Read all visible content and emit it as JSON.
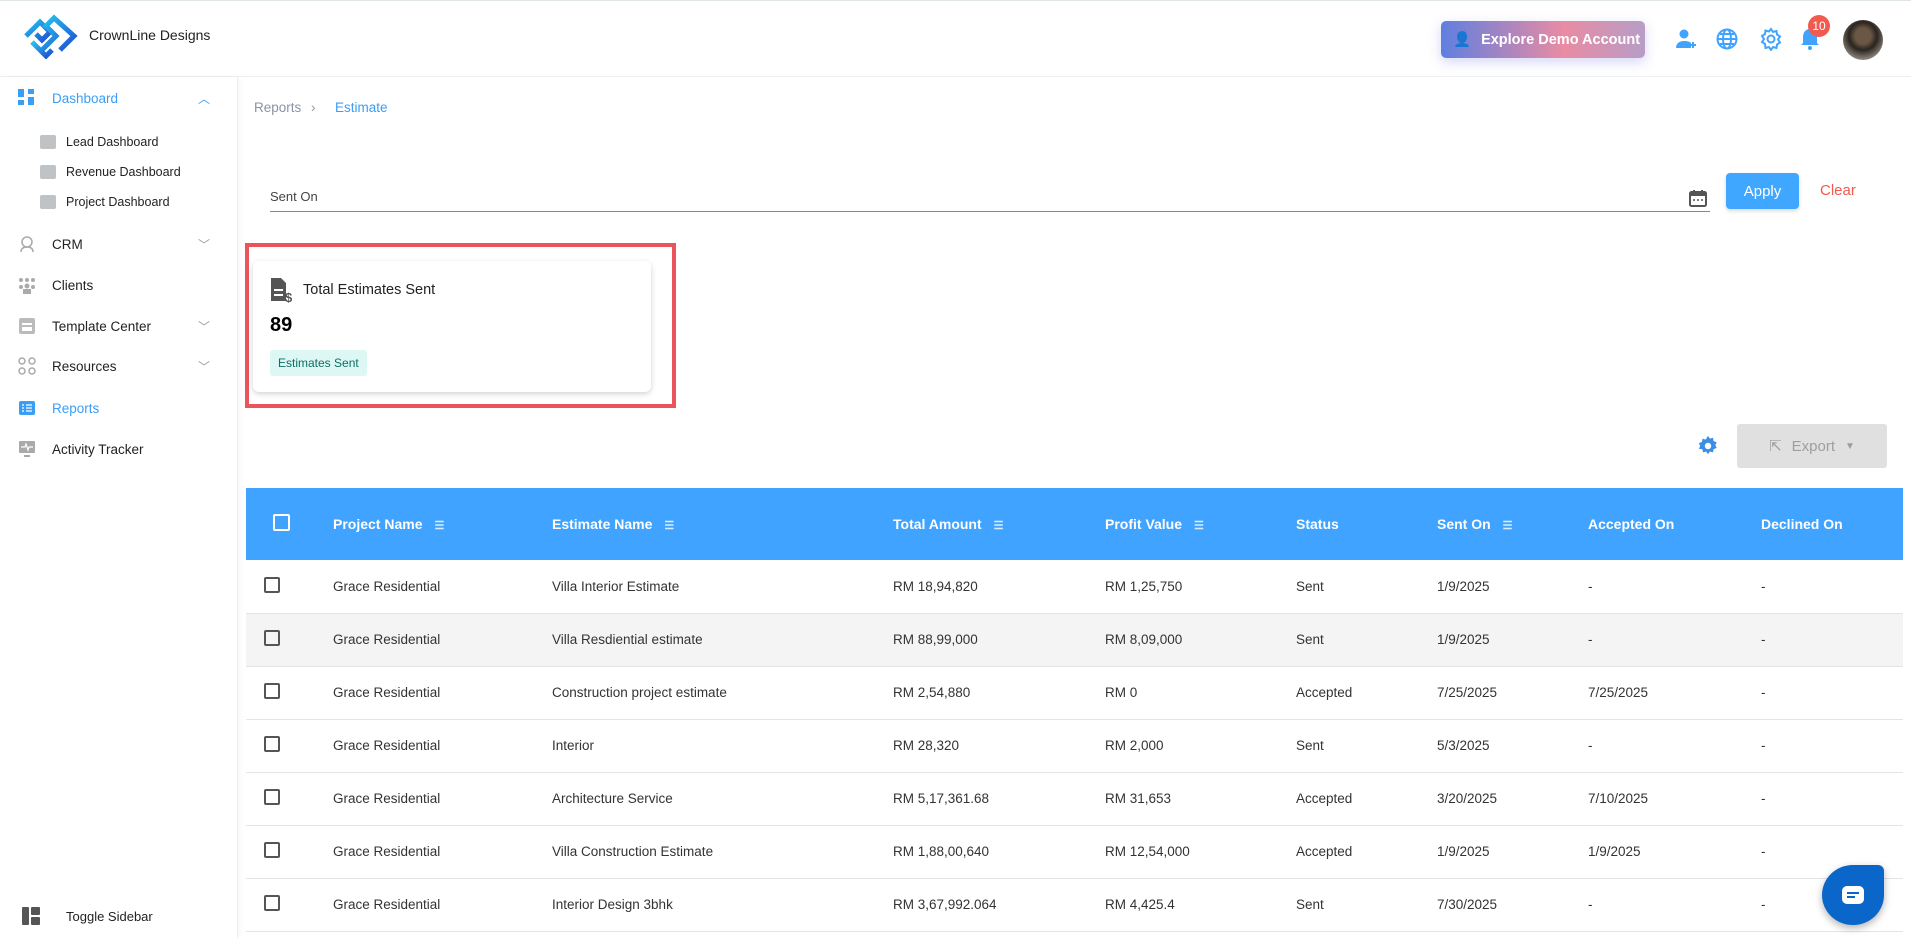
{
  "header": {
    "brand": "CrownLine Designs",
    "demo_button": "Explore Demo Account",
    "notification_count": "10",
    "accent": "#3fa3ff"
  },
  "sidebar": {
    "items": [
      {
        "label": "Dashboard"
      },
      {
        "label": "Lead Dashboard"
      },
      {
        "label": "Revenue Dashboard"
      },
      {
        "label": "Project Dashboard"
      },
      {
        "label": "CRM"
      },
      {
        "label": "Clients"
      },
      {
        "label": "Template Center"
      },
      {
        "label": "Resources"
      },
      {
        "label": "Reports"
      },
      {
        "label": "Activity Tracker"
      }
    ],
    "toggle": "Toggle Sidebar"
  },
  "breadcrumb": {
    "parent": "Reports",
    "current": "Estimate"
  },
  "filter": {
    "label": "Sent On",
    "apply": "Apply",
    "clear": "Clear"
  },
  "card": {
    "title": "Total Estimates Sent",
    "value": "89",
    "tag": "Estimates Sent"
  },
  "toolbar": {
    "export": "Export"
  },
  "table": {
    "headers": [
      "Project Name",
      "Estimate Name",
      "Total Amount",
      "Profit Value",
      "Status",
      "Sent On",
      "Accepted On",
      "Declined On"
    ],
    "rows": [
      [
        "Grace Residential",
        "Villa Interior Estimate",
        "RM 18,94,820",
        "RM 1,25,750",
        "Sent",
        "1/9/2025",
        "-",
        "-"
      ],
      [
        "Grace Residential",
        "Villa Resdiential estimate",
        "RM 88,99,000",
        "RM 8,09,000",
        "Sent",
        "1/9/2025",
        "-",
        "-"
      ],
      [
        "Grace Residential",
        "Construction project estimate",
        "RM 2,54,880",
        "RM 0",
        "Accepted",
        "7/25/2025",
        "7/25/2025",
        "-"
      ],
      [
        "Grace Residential",
        "Interior",
        "RM 28,320",
        "RM 2,000",
        "Sent",
        "5/3/2025",
        "-",
        "-"
      ],
      [
        "Grace Residential",
        "Architecture Service",
        "RM 5,17,361.68",
        "RM 31,653",
        "Accepted",
        "3/20/2025",
        "7/10/2025",
        "-"
      ],
      [
        "Grace Residential",
        "Villa Construction Estimate",
        "RM 1,88,00,640",
        "RM 12,54,000",
        "Accepted",
        "1/9/2025",
        "1/9/2025",
        "-"
      ],
      [
        "Grace Residential",
        "Interior Design 3bhk",
        "RM 3,67,992.064",
        "RM 4,425.4",
        "Sent",
        "7/30/2025",
        "-",
        "-"
      ]
    ]
  }
}
